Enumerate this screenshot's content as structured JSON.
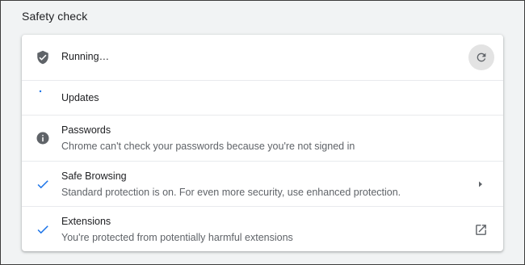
{
  "section": {
    "title": "Safety check"
  },
  "colors": {
    "accent": "#1a73e8",
    "icon_gray": "#5f6368",
    "page_bg": "#f1f3f4",
    "card_bg": "#ffffff"
  },
  "rows": [
    {
      "icon": "shield-check-icon",
      "title": "Running…",
      "trailing": "refresh-icon"
    },
    {
      "icon": "spinner-icon",
      "title": "Updates"
    },
    {
      "icon": "info-icon",
      "title": "Passwords",
      "subtitle": "Chrome can't check your passwords because you're not signed in"
    },
    {
      "icon": "checkmark-icon",
      "title": "Safe Browsing",
      "subtitle": "Standard protection is on. For even more security, use enhanced protection.",
      "trailing": "chevron-right-icon"
    },
    {
      "icon": "checkmark-icon",
      "title": "Extensions",
      "subtitle": "You're protected from potentially harmful extensions",
      "trailing": "open-in-new-icon"
    }
  ]
}
